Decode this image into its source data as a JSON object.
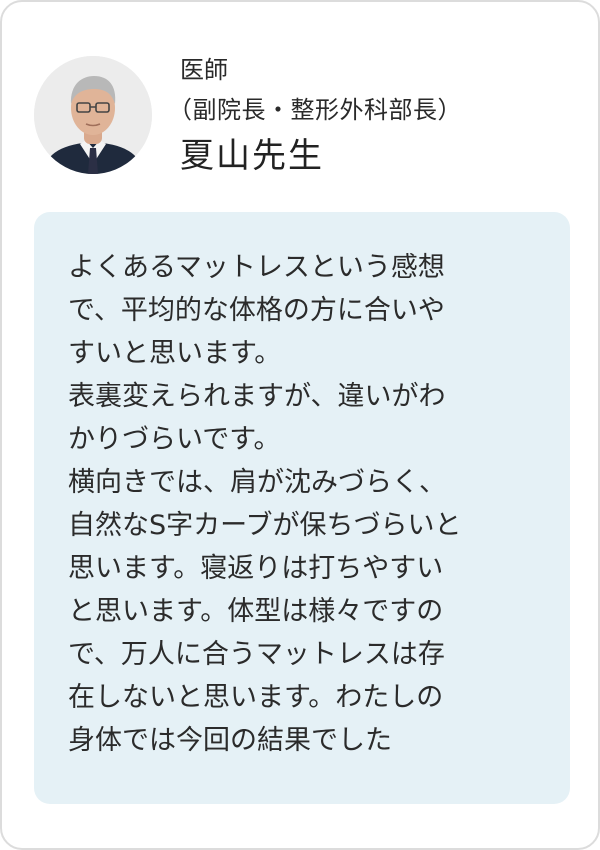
{
  "profile": {
    "role": "医師",
    "department": "（副院長・整形外科部長）",
    "name": "夏山先生",
    "avatar_icon": "doctor-portrait-icon"
  },
  "comment": {
    "text": "よくあるマットレスという感想\nで、平均的な体格の方に合いや\nすいと思います。\n表裏変えられますが、違いがわ\nかりづらいです。\n横向きでは、肩が沈みづらく、\n自然なS字カーブが保ちづらいと\n思います。寝返りは打ちやすい\nと思います。体型は様々ですの\nで、万人に合うマットレスは存\n在しないと思います。わたしの\n身体では今回の結果でした"
  },
  "colors": {
    "comment_background": "#e5f1f6",
    "card_border": "#dcdcdc",
    "text": "#2b2b2b"
  }
}
